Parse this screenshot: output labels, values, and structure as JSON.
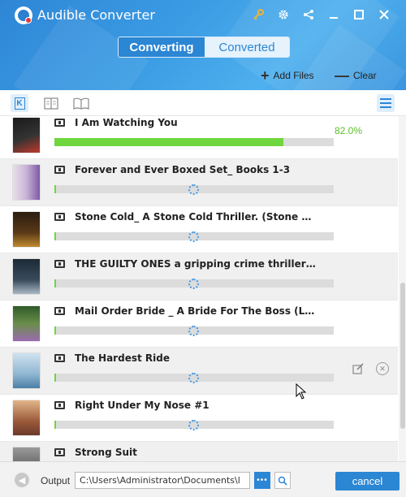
{
  "app": {
    "title": "Audible Converter"
  },
  "window_icons": [
    "key-icon",
    "gear-icon",
    "share-icon",
    "minimize-icon",
    "maximize-icon",
    "close-icon"
  ],
  "tabs": [
    {
      "label": "Converting",
      "active": true
    },
    {
      "label": "Converted",
      "active": false
    }
  ],
  "actions": {
    "add_files": "Add Files",
    "clear": "Clear"
  },
  "toolbar": {
    "views": [
      "kindle-view-icon",
      "open-book-icon",
      "book-icon"
    ],
    "menu": "menu-icon"
  },
  "items": [
    {
      "title": "I Am Watching You",
      "progress": 0.82,
      "percent": "82.0%",
      "status": "converting",
      "cover_colors": [
        "#111111",
        "#c0392b"
      ]
    },
    {
      "title": "Forever and Ever Boxed Set_ Books 1-3",
      "progress": 0,
      "percent": "",
      "status": "waiting",
      "cover_colors": [
        "#e8dfe8",
        "#7d5aa6"
      ]
    },
    {
      "title": "Stone Cold_ A Stone Cold Thriller. (Stone Cold Thrille...",
      "progress": 0,
      "percent": "",
      "status": "waiting",
      "cover_colors": [
        "#2a1d10",
        "#c08a2e"
      ]
    },
    {
      "title": "THE GUILTY ONES a gripping crime thriller filled wit...",
      "progress": 0,
      "percent": "",
      "status": "waiting",
      "cover_colors": [
        "#1c2a36",
        "#aab8c4"
      ]
    },
    {
      "title": "Mail Order Bride _ A Bride For The Boss (Ladies of Th...",
      "progress": 0,
      "percent": "",
      "status": "waiting",
      "cover_colors": [
        "#2f5a28",
        "#9b6bb0"
      ]
    },
    {
      "title": "The Hardest Ride",
      "progress": 0,
      "percent": "",
      "status": "waiting",
      "cover_colors": [
        "#cfe2ef",
        "#4c7fa6"
      ]
    },
    {
      "title": "Right Under My Nose #1",
      "progress": 0,
      "percent": "",
      "status": "waiting",
      "cover_colors": [
        "#6b3a2a",
        "#e0b58a"
      ]
    },
    {
      "title": "Strong Suit",
      "progress": 0,
      "percent": "",
      "status": "waiting",
      "cover_colors": [
        "#3b3b3b",
        "#9a9a9a"
      ]
    }
  ],
  "row_actions": [
    "edit-icon",
    "remove-icon"
  ],
  "footer": {
    "output_label": "Output",
    "output_path": "C:\\Users\\Administrator\\Documents\\l",
    "browse_label": "•••",
    "cancel_label": "cancel"
  },
  "colors": {
    "accent": "#2b86d4",
    "progress": "#6fd63e",
    "percent_text": "#5cbf2a"
  }
}
